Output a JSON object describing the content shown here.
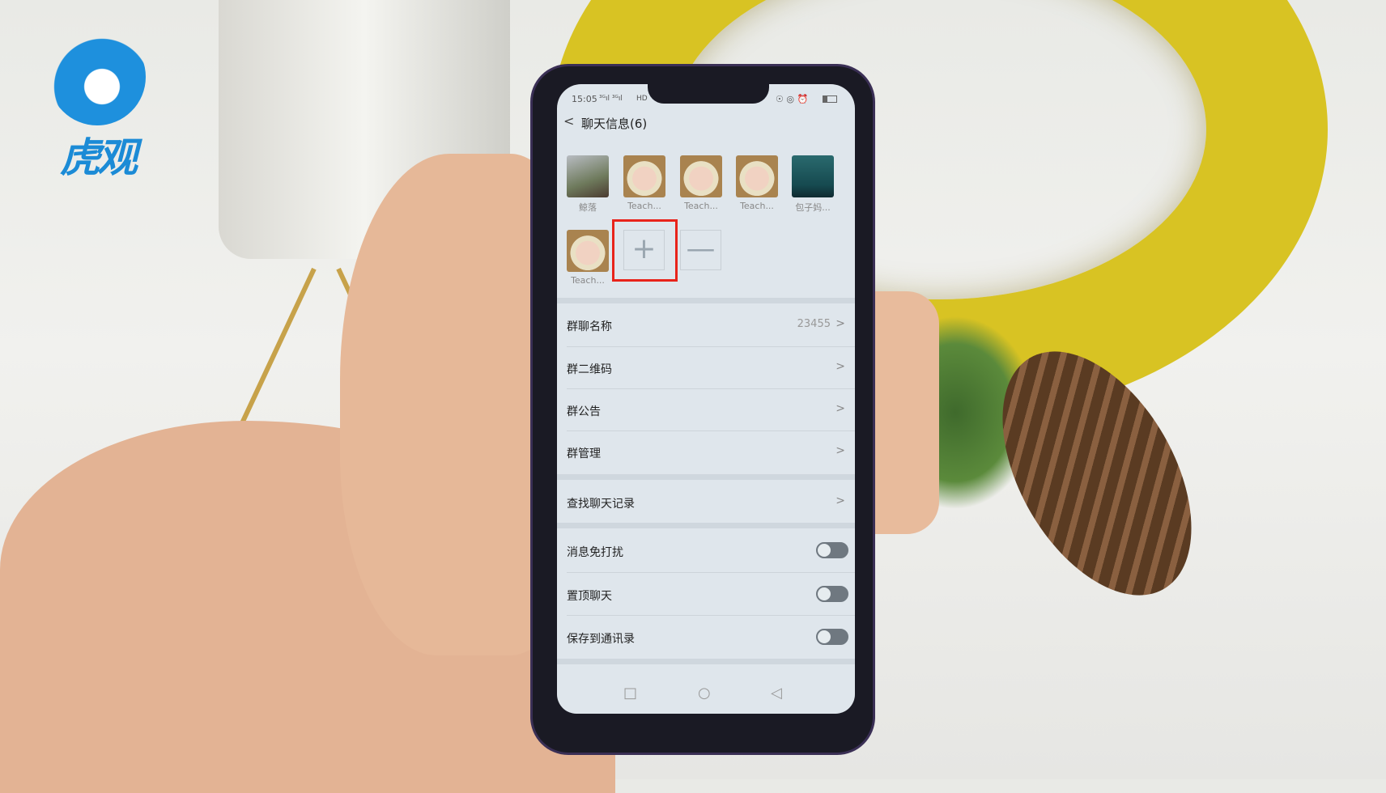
{
  "logo": {
    "text": "虎观",
    "color": "#1b8bd6"
  },
  "status_bar": {
    "time": "15:05",
    "signal": "³ᴳıl ³ᴳıl",
    "wifi": "wifi",
    "hd": "HD",
    "right_icons": "☉ ◎ ⏰",
    "battery": "battery-icon"
  },
  "header": {
    "back": "<",
    "title": "聊天信息(6)"
  },
  "members": [
    {
      "name": "鲸落",
      "avatar": "photo"
    },
    {
      "name": "Teach...",
      "avatar": "baby"
    },
    {
      "name": "Teach...",
      "avatar": "baby"
    },
    {
      "name": "Teach...",
      "avatar": "baby"
    },
    {
      "name": "包子妈...",
      "avatar": "plant"
    },
    {
      "name": "Teach...",
      "avatar": "baby"
    }
  ],
  "add_button": "+",
  "remove_button": "—",
  "highlight_color": "#e8231a",
  "settings": [
    {
      "label": "群聊名称",
      "value": "23455",
      "chevron": ">"
    },
    {
      "label": "群二维码",
      "chevron": ">"
    },
    {
      "label": "群公告",
      "chevron": ">"
    },
    {
      "label": "群管理",
      "chevron": ">"
    },
    {
      "label": "查找聊天记录",
      "chevron": ">"
    }
  ],
  "toggles": [
    {
      "label": "消息免打扰",
      "on": false
    },
    {
      "label": "置顶聊天",
      "on": false
    },
    {
      "label": "保存到通讯录",
      "on": false
    }
  ],
  "nav": {
    "recent": "□",
    "home": "○",
    "back": "◁"
  }
}
